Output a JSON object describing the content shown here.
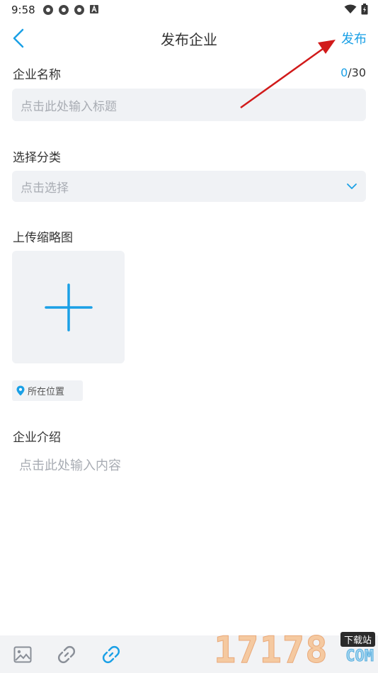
{
  "status_bar": {
    "time": "9:58",
    "left_icons": [
      "settings-icon",
      "settings-icon",
      "settings-icon",
      "app-a-icon"
    ],
    "right_icons": [
      "wifi-icon",
      "battery-icon"
    ]
  },
  "nav": {
    "title": "发布企业",
    "publish_label": "发布",
    "back_icon": "chevron-left-icon"
  },
  "form": {
    "name_label": "企业名称",
    "name_counter_current": "0",
    "name_counter_total": "/30",
    "name_placeholder": "点击此处输入标题",
    "category_label": "选择分类",
    "category_placeholder": "点击选择",
    "thumbnail_label": "上传缩略图",
    "location_label": "所在位置",
    "intro_label": "企业介绍",
    "intro_placeholder": "点击此处输入内容"
  },
  "toolbar": {
    "icons": [
      "image-icon",
      "link-icon",
      "link-icon"
    ]
  },
  "watermark": {
    "digits": "17178",
    "tag": "下载站",
    "com": "COM"
  },
  "colors": {
    "accent": "#1aa0e6",
    "input_bg": "#f0f2f5",
    "placeholder": "#a8acb3",
    "annotation_arrow": "#d11a1a"
  }
}
